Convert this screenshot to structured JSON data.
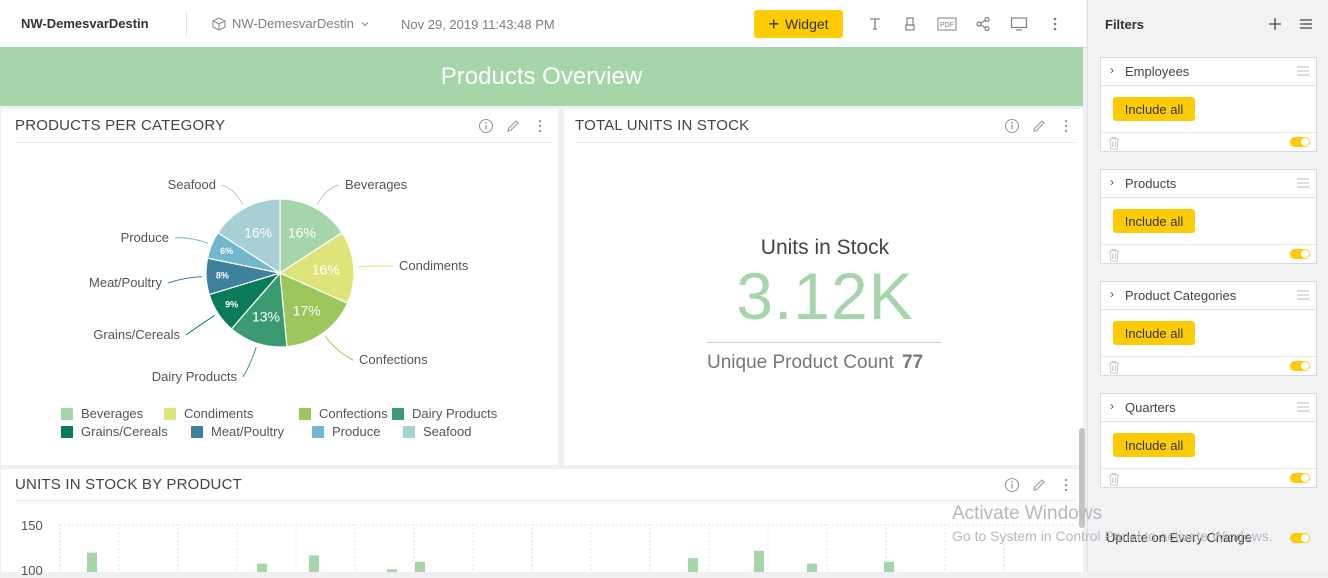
{
  "header": {
    "dashboard_name": "NW-DemesvarDestin",
    "datasource": "NW-DemesvarDestin",
    "timestamp": "Nov 29, 2019 11:43:48 PM",
    "widget_button": "Widget",
    "icons": [
      "text-icon",
      "brush-icon",
      "pdf-icon",
      "share-icon",
      "monitor-icon",
      "more-icon"
    ]
  },
  "banner": {
    "title": "Products Overview"
  },
  "panels": {
    "products_per_category": {
      "title": "PRODUCTS PER CATEGORY"
    },
    "total_units": {
      "title": "TOTAL UNITS IN STOCK",
      "kpi_title": "Units in Stock",
      "kpi_value": "3.12K",
      "secondary_label": "Unique Product Count",
      "secondary_value": "77"
    },
    "units_by_product": {
      "title": "UNITS IN STOCK BY PRODUCT"
    }
  },
  "chart_data": [
    {
      "type": "pie",
      "title": "PRODUCTS PER CATEGORY",
      "categories": [
        "Beverages",
        "Condiments",
        "Confections",
        "Dairy Products",
        "Grains/Cereals",
        "Meat/Poultry",
        "Produce",
        "Seafood"
      ],
      "values": [
        16,
        16,
        17,
        13,
        9,
        8,
        6,
        16
      ],
      "labels": [
        "16%",
        "16%",
        "17%",
        "13%",
        "9%",
        "8%",
        "6%",
        "16%"
      ],
      "colors": [
        "#a6d5a9",
        "#dde57a",
        "#9cc75c",
        "#3b9a70",
        "#0a7a5a",
        "#3e819c",
        "#72b7cc",
        "#a8cfd6"
      ],
      "legend": "bottom"
    },
    {
      "type": "bar",
      "title": "UNITS IN STOCK BY PRODUCT",
      "y_ticks": [
        "150",
        "100"
      ],
      "values": [
        120,
        108,
        117,
        102,
        110,
        114,
        122,
        108,
        110
      ],
      "color": "#a6d5a9"
    }
  ],
  "filters": {
    "title": "Filters",
    "items": [
      {
        "name": "Employees",
        "button": "Include all"
      },
      {
        "name": "Products",
        "button": "Include all"
      },
      {
        "name": "Product Categories",
        "button": "Include all"
      },
      {
        "name": "Quarters",
        "button": "Include all"
      }
    ],
    "update_label": "Update on Every Change"
  },
  "watermark": {
    "line1": "Activate Windows",
    "line2": "Go to System in Control Panel to activate Windows."
  }
}
